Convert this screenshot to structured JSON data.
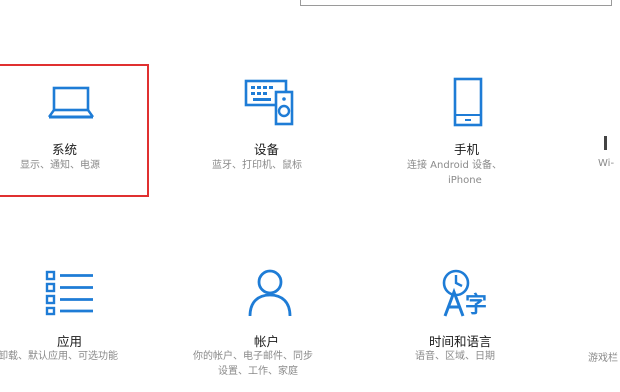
{
  "colors": {
    "accent": "#1e7cd6",
    "selection_border": "#e03030",
    "title_text": "#1a1a1a",
    "desc_text": "#8a8a8a"
  },
  "tiles": [
    {
      "icon": "laptop-icon",
      "title": "系统",
      "desc_lines": [
        "显示、通知、电源"
      ]
    },
    {
      "icon": "devices-icon",
      "title": "设备",
      "desc_lines": [
        "蓝牙、打印机、鼠标"
      ]
    },
    {
      "icon": "phone-icon",
      "title": "手机",
      "desc_lines": [
        "连接 Android 设备、",
        "iPhone"
      ]
    },
    {
      "icon": "apps-list-icon",
      "title": "应用",
      "desc_lines": [
        "卸载、默认应用、可选功能"
      ]
    },
    {
      "icon": "person-icon",
      "title": "帐户",
      "desc_lines": [
        "你的帐户、电子邮件、同步",
        "设置、工作、家庭"
      ]
    },
    {
      "icon": "time-language-icon",
      "title": "时间和语言",
      "desc_lines": [
        "语音、区域、日期"
      ]
    }
  ],
  "edge_fragments": {
    "network_desc": "Wi-",
    "gaming_desc": "游戏栏"
  }
}
